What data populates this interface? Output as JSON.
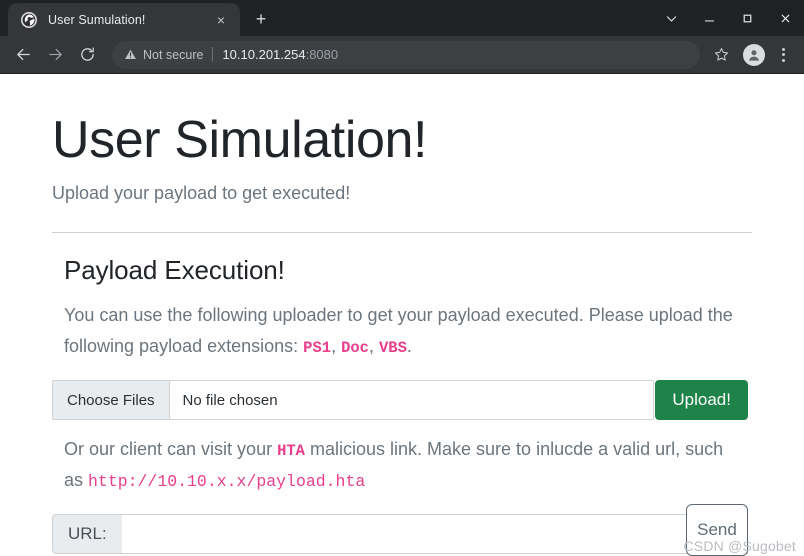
{
  "browser": {
    "tab": {
      "title": "User Sumulation!",
      "favicon": "globe-icon",
      "close_label": "×"
    },
    "new_tab_label": "+",
    "window_controls": {
      "expand_label": "⌄",
      "minimize_label": "–",
      "maximize_label": "□",
      "close_label": "×"
    },
    "nav": {
      "back_label": "←",
      "forward_label": "→",
      "reload_label": "↻"
    },
    "omnibox": {
      "security_label": "Not secure",
      "security_icon": "warning-triangle-icon",
      "host": "10.10.201.254",
      "port": ":8080"
    },
    "bookmark_icon": "star-icon",
    "profile_icon": "person-avatar-icon",
    "menu_icon": "three-dot-menu-icon"
  },
  "page": {
    "title": "User Simulation!",
    "lead": "Upload your payload to get executed!",
    "section": {
      "heading": "Payload Execution!",
      "paragraph_prefix": "You can use the following uploader to get your payload executed. Please upload the following payload extensions: ",
      "extensions": [
        "PS1",
        "Doc",
        "VBS"
      ],
      "paragraph_suffix": ".",
      "upload": {
        "choose_label": "Choose Files",
        "no_file_text": "No file chosen",
        "upload_button": "Upload!"
      },
      "hta_prefix": "Or our client can visit your ",
      "hta_code": "HTA",
      "hta_middle": " malicious link. Make sure to inlucde a valid url, such as ",
      "hta_url": "http://10.10.x.x/payload.hta",
      "url_form": {
        "label": "URL:",
        "value": "",
        "placeholder": "",
        "send_button": "Send"
      }
    }
  },
  "watermark": "CSDN @Sugobet",
  "colors": {
    "accent_pink": "#e83e8c",
    "upload_green": "#1d8348",
    "chrome_dark": "#202124",
    "toolbar_dark": "#35363a"
  }
}
